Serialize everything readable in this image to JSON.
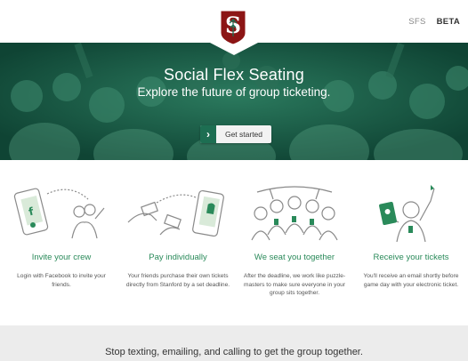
{
  "nav": {
    "sfs": "SFS",
    "beta": "BETA"
  },
  "hero": {
    "title": "Social Flex Seating",
    "subtitle": "Explore the future of group ticketing.",
    "cta_label": "Get started"
  },
  "features": [
    {
      "title": "Invite your crew",
      "text": "Login with Facebook to invite your friends."
    },
    {
      "title": "Pay individually",
      "text": "Your friends purchase their own tickets directly from Stanford by a set deadline."
    },
    {
      "title": "We seat you together",
      "text": "After the deadline, we work like puzzle-masters to make sure everyone in your group sits together."
    },
    {
      "title": "Receive your tickets",
      "text": "You'll receive an email shortly before game day with your electronic ticket."
    }
  ],
  "footer": {
    "tagline": "Stop texting, emailing, and calling to get the group together."
  },
  "colors": {
    "brand_red": "#8c1515",
    "accent_green": "#2a8a5a",
    "hero_green": "#14513f"
  }
}
